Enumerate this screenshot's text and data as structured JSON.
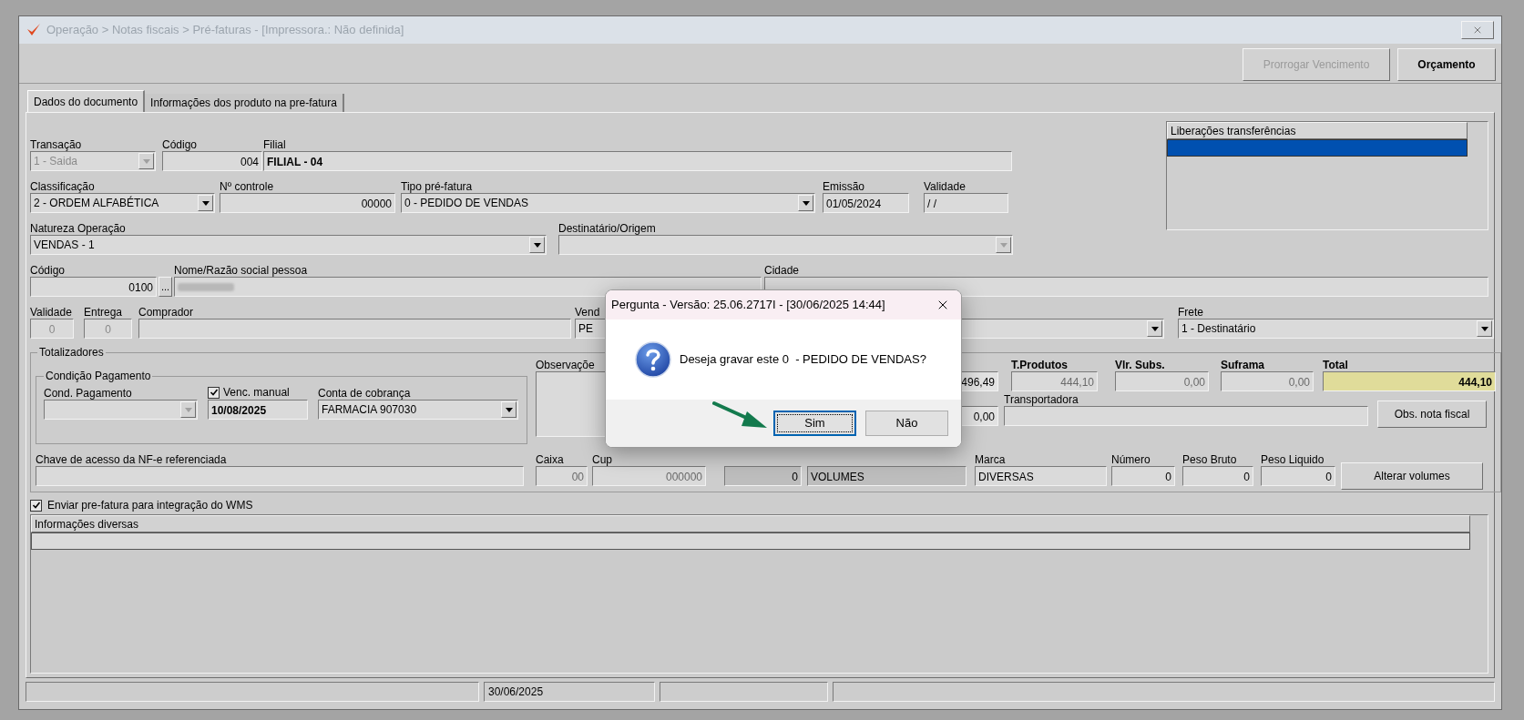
{
  "window": {
    "title": "Operação > Notas fiscais > Pré-faturas - [Impressora.: Não definida]"
  },
  "toolbar": {
    "buttons": [
      {
        "label": "Prorrogar Vencimento",
        "disabled": true
      },
      {
        "label": "Orçamento",
        "disabled": false
      }
    ]
  },
  "tabs": [
    {
      "label": "Dados do documento",
      "selected": true
    },
    {
      "label": "Informações dos produto na pre-fatura",
      "selected": false
    }
  ],
  "form": {
    "transacao": {
      "label": "Transação",
      "value": "1 - Saida",
      "disabled": true
    },
    "codigo_filial": {
      "label": "Código",
      "value": "004"
    },
    "filial": {
      "label": "Filial",
      "value": "FILIAL - 04"
    },
    "classificacao": {
      "label": "Classificação",
      "value": "2 - ORDEM ALFABÉTICA",
      "disabled": false
    },
    "n_controle": {
      "label": "Nº controle",
      "value": "00000"
    },
    "tipo_pre_fatura": {
      "label": "Tipo pré-fatura",
      "value": "0 - PEDIDO DE VENDAS",
      "disabled": false
    },
    "emissao": {
      "label": "Emissão",
      "value": "01/05/2024"
    },
    "validade_data": {
      "label": "Validade",
      "value": "/ /"
    },
    "natureza_operacao": {
      "label": "Natureza  Operação",
      "value": "VENDAS - 1",
      "disabled": false
    },
    "destinatario_origem": {
      "label": "Destinatário/Origem",
      "disabled": true
    },
    "codigo_pessoa": {
      "label": "Código",
      "value": "0100"
    },
    "lookup_button": {
      "label": "..."
    },
    "nome_razao_social": {
      "label": "Nome/Razão social pessoa"
    },
    "cidade": {
      "label": "Cidade"
    },
    "validade_dias": {
      "label": "Validade",
      "value": "0"
    },
    "entrega": {
      "label": "Entrega",
      "value": "0"
    },
    "comprador": {
      "label": "Comprador"
    },
    "vendedor": {
      "label": "Vend",
      "value": "PE",
      "disabled": false
    },
    "frete": {
      "label": "Frete",
      "value": "1 - Destinatário",
      "disabled": false
    }
  },
  "liberacoes": {
    "header": "Liberações transferências",
    "rows": [
      {
        "selected": true
      }
    ]
  },
  "totalizadores": {
    "title": "Totalizadores",
    "condicao_pagamento": {
      "title": "Condição Pagamento",
      "cond_pagamento": {
        "label": "Cond. Pagamento",
        "disabled": true
      },
      "venc_manual": {
        "label": "Venc. manual",
        "checked": true,
        "value": "10/08/2025"
      },
      "conta_cobranca": {
        "label": "Conta de cobrança",
        "value": "FARMACIA 907030",
        "disabled": false
      }
    },
    "observacoes": {
      "label": "Observaçõe"
    },
    "column_1": {
      "value": "496,49"
    },
    "t_produtos": {
      "label": "T.Produtos",
      "value": "444,10"
    },
    "vlr_subs": {
      "label": "Vlr. Subs.",
      "value": "0,00"
    },
    "suframa": {
      "label": "Suframa",
      "value": "0,00"
    },
    "total": {
      "label": "Total",
      "value": "444,10"
    },
    "column_2": {
      "value": "0,00"
    },
    "transportadora": {
      "label": "Transportadora"
    },
    "obs_nota_fiscal": {
      "label": "Obs. nota fiscal"
    },
    "chave_acesso": {
      "label": "Chave de acesso da NF-e referenciada"
    },
    "caixa": {
      "label": "Caixa",
      "value": "00"
    },
    "cupom": {
      "label": "Cup",
      "value": "000000"
    },
    "column_3": {
      "value": "0"
    },
    "column_4": {
      "value": "VOLUMES"
    },
    "marca": {
      "label": "Marca",
      "value": "DIVERSAS"
    },
    "numero": {
      "label": "Número",
      "value": "0"
    },
    "peso_bruto": {
      "label": "Peso Bruto",
      "value": "0"
    },
    "peso_liquido": {
      "label": "Peso Liquido",
      "value": "0"
    },
    "alterar_volumes": {
      "label": "Alterar volumes"
    }
  },
  "enviar_wms": {
    "label": "Enviar pre-fatura para integração do WMS",
    "checked": true
  },
  "informacoes_diversas": {
    "header": "Informações diversas"
  },
  "status_bar": {
    "date": "30/06/2025"
  },
  "dialog": {
    "title": "Pergunta - Versão: 25.06.2717I - [30/06/2025 14:44]",
    "message": "Deseja gravar este 0  - PEDIDO DE VENDAS?",
    "buttons": [
      {
        "label": "Sim",
        "selected": true
      },
      {
        "label": "Não",
        "selected": false
      }
    ]
  }
}
